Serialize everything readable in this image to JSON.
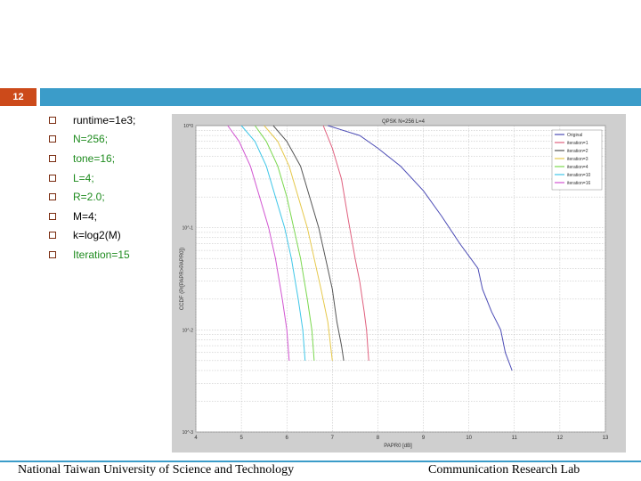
{
  "slide": {
    "number": "12"
  },
  "bullets": [
    {
      "text": "runtime=1e3;",
      "color": "black"
    },
    {
      "text": "N=256;",
      "color": "green"
    },
    {
      "text": "tone=16;",
      "color": "green"
    },
    {
      "text": "L=4;",
      "color": "green"
    },
    {
      "text": "R=2.0;",
      "color": "green"
    },
    {
      "text": "M=4;",
      "color": "black"
    },
    {
      "text": "k=log2(M)",
      "color": "black"
    },
    {
      "text": "Iteration=15",
      "color": "green"
    }
  ],
  "footer": {
    "left": "National Taiwan University of Science and Technology",
    "right": "Communication Research Lab"
  },
  "colors": {
    "header_bar": "#3b9cc9",
    "badge": "#cc4a1a",
    "figure_bg": "#cfcfcf"
  },
  "chart_data": {
    "type": "line",
    "title": "QPSK N=256 L=4",
    "xlabel": "PAPR0 [dB]",
    "ylabel": "CCDF (Pr[PAPR>PAPR0])",
    "xlim": [
      4,
      13
    ],
    "ylim": [
      0.001,
      1
    ],
    "yscale": "log",
    "grid": true,
    "legend_position": "top-right",
    "x_ticks": [
      "4",
      "5",
      "6",
      "7",
      "8",
      "9",
      "10",
      "11",
      "12",
      "13"
    ],
    "y_ticks": [
      "10^-3",
      "10^-2",
      "10^-1",
      "10^0"
    ],
    "series": [
      {
        "name": "Original",
        "color": "#4b4bb5",
        "x": [
          6.9,
          7.6,
          8.0,
          8.5,
          9.0,
          9.4,
          9.8,
          10.2,
          10.3,
          10.5,
          10.7,
          10.8,
          10.95
        ],
        "y": [
          1,
          0.8,
          0.6,
          0.4,
          0.23,
          0.13,
          0.07,
          0.04,
          0.025,
          0.015,
          0.01,
          0.006,
          0.004
        ]
      },
      {
        "name": "iteration=1",
        "color": "#e0607e",
        "x": [
          6.8,
          7.0,
          7.2,
          7.35,
          7.5,
          7.6,
          7.7,
          7.75,
          7.8
        ],
        "y": [
          1,
          0.6,
          0.3,
          0.12,
          0.05,
          0.03,
          0.015,
          0.01,
          0.005
        ]
      },
      {
        "name": "iteration=2",
        "color": "#555555",
        "x": [
          5.7,
          6.0,
          6.3,
          6.5,
          6.7,
          6.85,
          7.0,
          7.1,
          7.2,
          7.25
        ],
        "y": [
          1,
          0.7,
          0.4,
          0.2,
          0.1,
          0.05,
          0.025,
          0.012,
          0.007,
          0.005
        ]
      },
      {
        "name": "iteration=3",
        "color": "#e6c84a",
        "x": [
          5.5,
          5.8,
          6.05,
          6.25,
          6.45,
          6.6,
          6.75,
          6.9,
          7.0
        ],
        "y": [
          1,
          0.7,
          0.4,
          0.2,
          0.1,
          0.05,
          0.025,
          0.012,
          0.005
        ]
      },
      {
        "name": "iteration=4",
        "color": "#7ad84e",
        "x": [
          5.3,
          5.55,
          5.8,
          6.0,
          6.15,
          6.3,
          6.45,
          6.55,
          6.6
        ],
        "y": [
          1,
          0.7,
          0.4,
          0.2,
          0.1,
          0.05,
          0.02,
          0.01,
          0.005
        ]
      },
      {
        "name": "iteration=10",
        "color": "#3ec6e8",
        "x": [
          5.0,
          5.3,
          5.55,
          5.75,
          5.95,
          6.1,
          6.25,
          6.35,
          6.4
        ],
        "y": [
          1,
          0.7,
          0.4,
          0.2,
          0.1,
          0.05,
          0.02,
          0.01,
          0.005
        ]
      },
      {
        "name": "iteration=16",
        "color": "#d154d1",
        "x": [
          4.7,
          4.95,
          5.2,
          5.4,
          5.6,
          5.75,
          5.9,
          6.0,
          6.05
        ],
        "y": [
          1,
          0.7,
          0.4,
          0.2,
          0.1,
          0.05,
          0.02,
          0.01,
          0.005
        ]
      }
    ]
  }
}
